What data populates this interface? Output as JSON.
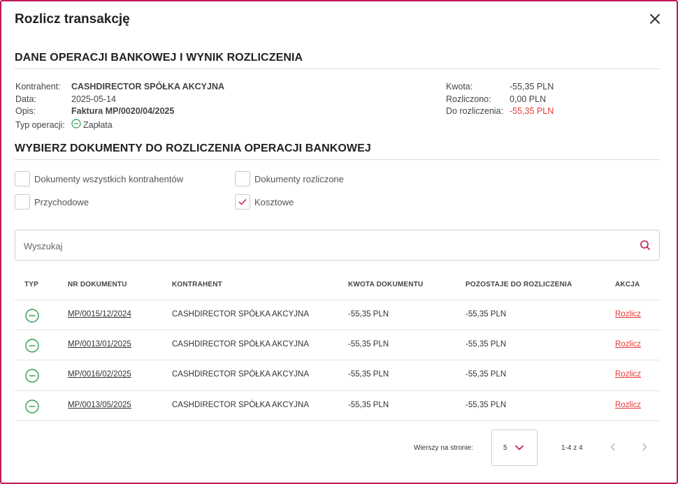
{
  "dialog": {
    "title": "Rozlicz transakcję",
    "close_icon": "close-icon"
  },
  "bank_op": {
    "section_title": "DANE OPERACJI BANKOWEJ I WYNIK ROZLICZENIA",
    "left": {
      "kontrahent_label": "Kontrahent:",
      "kontrahent_value": "CASHDIRECTOR SPÓŁKA AKCYJNA",
      "data_label": "Data:",
      "data_value": "2025-05-14",
      "opis_label": "Opis:",
      "opis_value": "Faktura MP/0020/04/2025",
      "typ_label": "Typ operacji:",
      "typ_value": "Zapłata",
      "typ_icon": "minus-circle-icon"
    },
    "right": {
      "kwota_label": "Kwota:",
      "kwota_value": "-55,35 PLN",
      "rozliczono_label": "Rozliczono:",
      "rozliczono_value": "0,00 PLN",
      "do_rozliczenia_label": "Do rozliczenia:",
      "do_rozliczenia_value": "-55,35 PLN"
    }
  },
  "select_docs": {
    "section_title": "WYBIERZ DOKUMENTY DO ROZLICZENIA OPERACJI BANKOWEJ",
    "checkboxes": {
      "all_contractors": {
        "label": "Dokumenty wszystkich kontrahentów",
        "checked": false
      },
      "settled": {
        "label": "Dokumenty rozliczone",
        "checked": false
      },
      "income": {
        "label": "Przychodowe",
        "checked": false
      },
      "cost": {
        "label": "Kosztowe",
        "checked": true
      }
    }
  },
  "search": {
    "placeholder": "Wyszukaj",
    "value": "",
    "icon": "search-icon"
  },
  "table": {
    "headers": {
      "typ": "TYP",
      "nr": "NR DOKUMENTU",
      "kontrahent": "KONTRAHENT",
      "kwota": "KWOTA DOKUMENTU",
      "pozostaje": "POZOSTAJE DO ROZLICZENIA",
      "akcja": "AKCJA"
    },
    "rows": [
      {
        "type_icon": "minus-circle-icon",
        "nr": "MP/0015/12/2024",
        "kontrahent": "CASHDIRECTOR SPÓŁKA AKCYJNA",
        "kwota": "-55,35 PLN",
        "pozostaje": "-55,35 PLN",
        "akcja": "Rozlicz"
      },
      {
        "type_icon": "minus-circle-icon",
        "nr": "MP/0013/01/2025",
        "kontrahent": "CASHDIRECTOR SPÓŁKA AKCYJNA",
        "kwota": "-55,35 PLN",
        "pozostaje": "-55,35 PLN",
        "akcja": "Rozlicz"
      },
      {
        "type_icon": "minus-circle-icon",
        "nr": "MP/0016/02/2025",
        "kontrahent": "CASHDIRECTOR SPÓŁKA AKCYJNA",
        "kwota": "-55,35 PLN",
        "pozostaje": "-55,35 PLN",
        "akcja": "Rozlicz"
      },
      {
        "type_icon": "minus-circle-icon",
        "nr": "MP/0013/05/2025",
        "kontrahent": "CASHDIRECTOR SPÓŁKA AKCYJNA",
        "kwota": "-55,35 PLN",
        "pozostaje": "-55,35 PLN",
        "akcja": "Rozlicz"
      }
    ]
  },
  "pagination": {
    "rows_per_page_label": "Wierszy na stronie:",
    "rows_per_page_value": "5",
    "range": "1-4 z 4"
  },
  "colors": {
    "accent": "#c2185b",
    "negative": "#e53935",
    "type_icon": "#2e9e4f"
  }
}
